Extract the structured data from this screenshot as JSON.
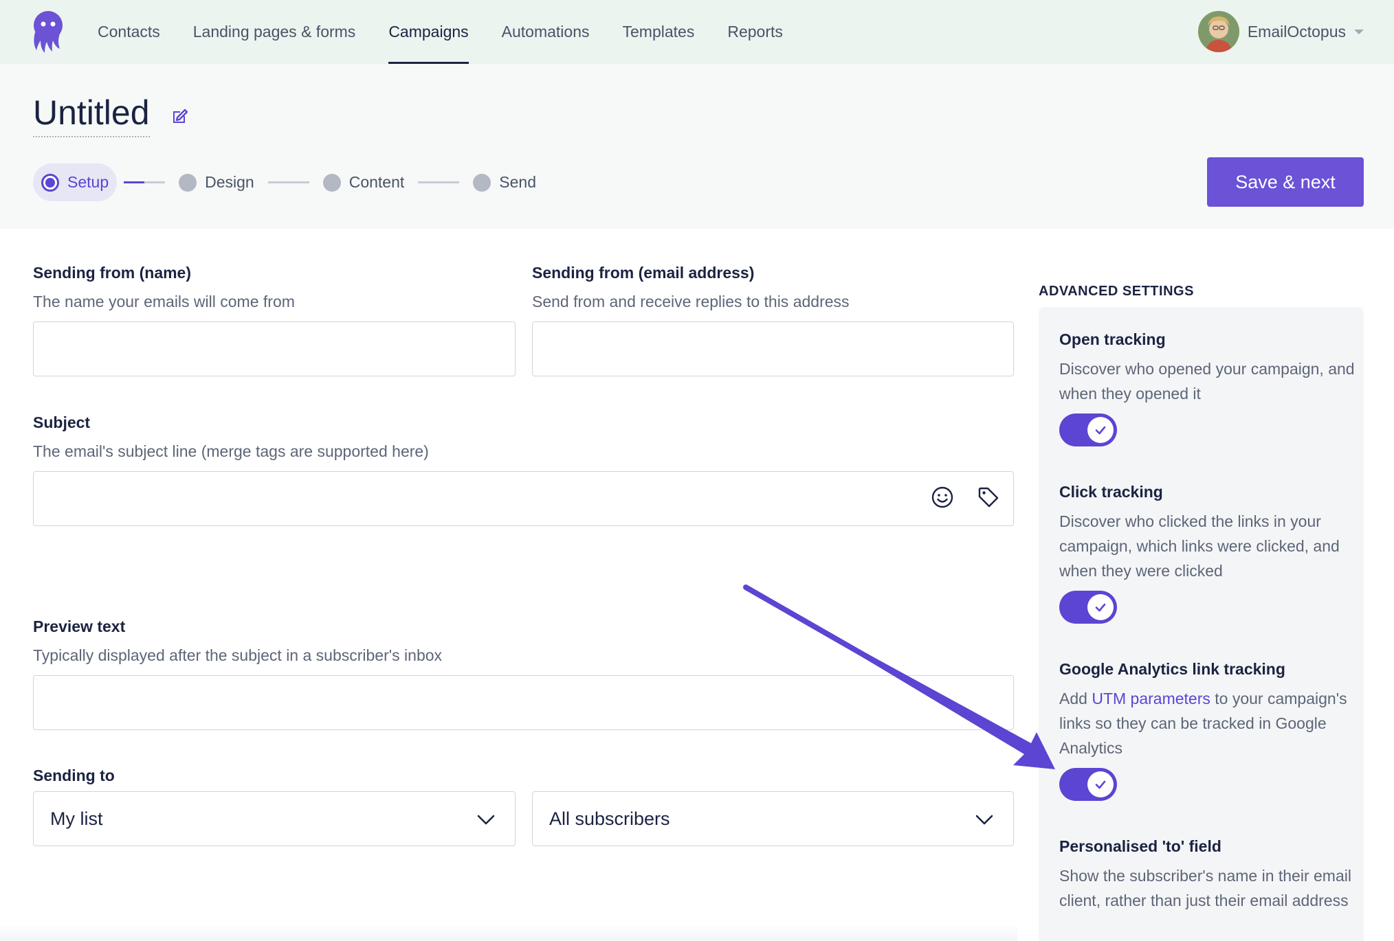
{
  "nav": {
    "logo_icon": "octopus-logo-icon",
    "links": [
      {
        "label": "Contacts",
        "active": false
      },
      {
        "label": "Landing pages & forms",
        "active": false
      },
      {
        "label": "Campaigns",
        "active": true
      },
      {
        "label": "Automations",
        "active": false
      },
      {
        "label": "Templates",
        "active": false
      },
      {
        "label": "Reports",
        "active": false
      }
    ],
    "account_name": "EmailOctopus"
  },
  "header": {
    "title": "Untitled",
    "steps": [
      {
        "label": "Setup",
        "active": true
      },
      {
        "label": "Design",
        "active": false
      },
      {
        "label": "Content",
        "active": false
      },
      {
        "label": "Send",
        "active": false
      }
    ],
    "save_label": "Save & next"
  },
  "form": {
    "from_name": {
      "label": "Sending from (name)",
      "help": "The name your emails will come from",
      "value": ""
    },
    "from_email": {
      "label": "Sending from (email address)",
      "help": "Send from and receive replies to this address",
      "value": ""
    },
    "subject": {
      "label": "Subject",
      "help": "The email's subject line (merge tags are supported here)",
      "value": ""
    },
    "preview": {
      "label": "Preview text",
      "help": "Typically displayed after the subject in a subscriber's inbox",
      "value": ""
    },
    "sending_to": {
      "label": "Sending to",
      "list_value": "My list",
      "segment_value": "All subscribers"
    }
  },
  "advanced": {
    "heading": "ADVANCED SETTINGS",
    "open_tracking": {
      "title": "Open tracking",
      "desc": "Discover who opened your campaign, and when they opened it",
      "enabled": true
    },
    "click_tracking": {
      "title": "Click tracking",
      "desc": "Discover who clicked the links in your campaign, which links were clicked, and when they were clicked",
      "enabled": true
    },
    "ga_tracking": {
      "title": "Google Analytics link tracking",
      "desc_prefix": "Add ",
      "desc_link": "UTM parameters",
      "desc_suffix": " to your campaign's links so they can be tracked in Google Analytics",
      "enabled": true
    },
    "personalised_to": {
      "title": "Personalised 'to' field",
      "desc": "Show the subscriber's name in their email client, rather than just their email address"
    }
  },
  "colors": {
    "accent": "#5b45d2",
    "button": "#6b52d6",
    "nav_bg": "#ecf4f0"
  }
}
